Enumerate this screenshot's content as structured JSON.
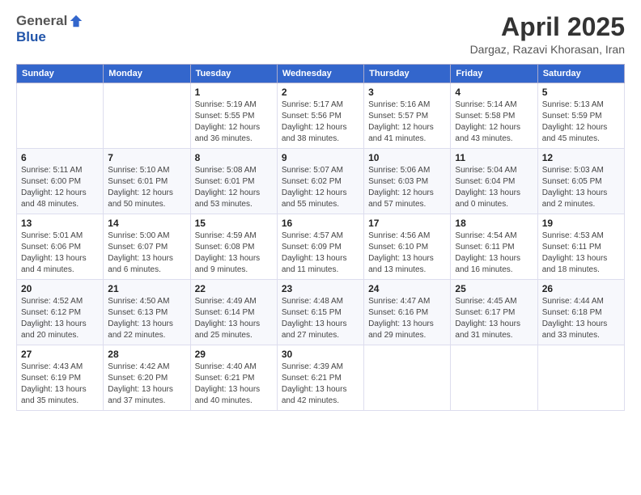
{
  "logo": {
    "general": "General",
    "blue": "Blue"
  },
  "header": {
    "title": "April 2025",
    "location": "Dargaz, Razavi Khorasan, Iran"
  },
  "days_of_week": [
    "Sunday",
    "Monday",
    "Tuesday",
    "Wednesday",
    "Thursday",
    "Friday",
    "Saturday"
  ],
  "weeks": [
    [
      {
        "day": "",
        "info": ""
      },
      {
        "day": "",
        "info": ""
      },
      {
        "day": "1",
        "info": "Sunrise: 5:19 AM\nSunset: 5:55 PM\nDaylight: 12 hours and 36 minutes."
      },
      {
        "day": "2",
        "info": "Sunrise: 5:17 AM\nSunset: 5:56 PM\nDaylight: 12 hours and 38 minutes."
      },
      {
        "day": "3",
        "info": "Sunrise: 5:16 AM\nSunset: 5:57 PM\nDaylight: 12 hours and 41 minutes."
      },
      {
        "day": "4",
        "info": "Sunrise: 5:14 AM\nSunset: 5:58 PM\nDaylight: 12 hours and 43 minutes."
      },
      {
        "day": "5",
        "info": "Sunrise: 5:13 AM\nSunset: 5:59 PM\nDaylight: 12 hours and 45 minutes."
      }
    ],
    [
      {
        "day": "6",
        "info": "Sunrise: 5:11 AM\nSunset: 6:00 PM\nDaylight: 12 hours and 48 minutes."
      },
      {
        "day": "7",
        "info": "Sunrise: 5:10 AM\nSunset: 6:01 PM\nDaylight: 12 hours and 50 minutes."
      },
      {
        "day": "8",
        "info": "Sunrise: 5:08 AM\nSunset: 6:01 PM\nDaylight: 12 hours and 53 minutes."
      },
      {
        "day": "9",
        "info": "Sunrise: 5:07 AM\nSunset: 6:02 PM\nDaylight: 12 hours and 55 minutes."
      },
      {
        "day": "10",
        "info": "Sunrise: 5:06 AM\nSunset: 6:03 PM\nDaylight: 12 hours and 57 minutes."
      },
      {
        "day": "11",
        "info": "Sunrise: 5:04 AM\nSunset: 6:04 PM\nDaylight: 13 hours and 0 minutes."
      },
      {
        "day": "12",
        "info": "Sunrise: 5:03 AM\nSunset: 6:05 PM\nDaylight: 13 hours and 2 minutes."
      }
    ],
    [
      {
        "day": "13",
        "info": "Sunrise: 5:01 AM\nSunset: 6:06 PM\nDaylight: 13 hours and 4 minutes."
      },
      {
        "day": "14",
        "info": "Sunrise: 5:00 AM\nSunset: 6:07 PM\nDaylight: 13 hours and 6 minutes."
      },
      {
        "day": "15",
        "info": "Sunrise: 4:59 AM\nSunset: 6:08 PM\nDaylight: 13 hours and 9 minutes."
      },
      {
        "day": "16",
        "info": "Sunrise: 4:57 AM\nSunset: 6:09 PM\nDaylight: 13 hours and 11 minutes."
      },
      {
        "day": "17",
        "info": "Sunrise: 4:56 AM\nSunset: 6:10 PM\nDaylight: 13 hours and 13 minutes."
      },
      {
        "day": "18",
        "info": "Sunrise: 4:54 AM\nSunset: 6:11 PM\nDaylight: 13 hours and 16 minutes."
      },
      {
        "day": "19",
        "info": "Sunrise: 4:53 AM\nSunset: 6:11 PM\nDaylight: 13 hours and 18 minutes."
      }
    ],
    [
      {
        "day": "20",
        "info": "Sunrise: 4:52 AM\nSunset: 6:12 PM\nDaylight: 13 hours and 20 minutes."
      },
      {
        "day": "21",
        "info": "Sunrise: 4:50 AM\nSunset: 6:13 PM\nDaylight: 13 hours and 22 minutes."
      },
      {
        "day": "22",
        "info": "Sunrise: 4:49 AM\nSunset: 6:14 PM\nDaylight: 13 hours and 25 minutes."
      },
      {
        "day": "23",
        "info": "Sunrise: 4:48 AM\nSunset: 6:15 PM\nDaylight: 13 hours and 27 minutes."
      },
      {
        "day": "24",
        "info": "Sunrise: 4:47 AM\nSunset: 6:16 PM\nDaylight: 13 hours and 29 minutes."
      },
      {
        "day": "25",
        "info": "Sunrise: 4:45 AM\nSunset: 6:17 PM\nDaylight: 13 hours and 31 minutes."
      },
      {
        "day": "26",
        "info": "Sunrise: 4:44 AM\nSunset: 6:18 PM\nDaylight: 13 hours and 33 minutes."
      }
    ],
    [
      {
        "day": "27",
        "info": "Sunrise: 4:43 AM\nSunset: 6:19 PM\nDaylight: 13 hours and 35 minutes."
      },
      {
        "day": "28",
        "info": "Sunrise: 4:42 AM\nSunset: 6:20 PM\nDaylight: 13 hours and 37 minutes."
      },
      {
        "day": "29",
        "info": "Sunrise: 4:40 AM\nSunset: 6:21 PM\nDaylight: 13 hours and 40 minutes."
      },
      {
        "day": "30",
        "info": "Sunrise: 4:39 AM\nSunset: 6:21 PM\nDaylight: 13 hours and 42 minutes."
      },
      {
        "day": "",
        "info": ""
      },
      {
        "day": "",
        "info": ""
      },
      {
        "day": "",
        "info": ""
      }
    ]
  ]
}
